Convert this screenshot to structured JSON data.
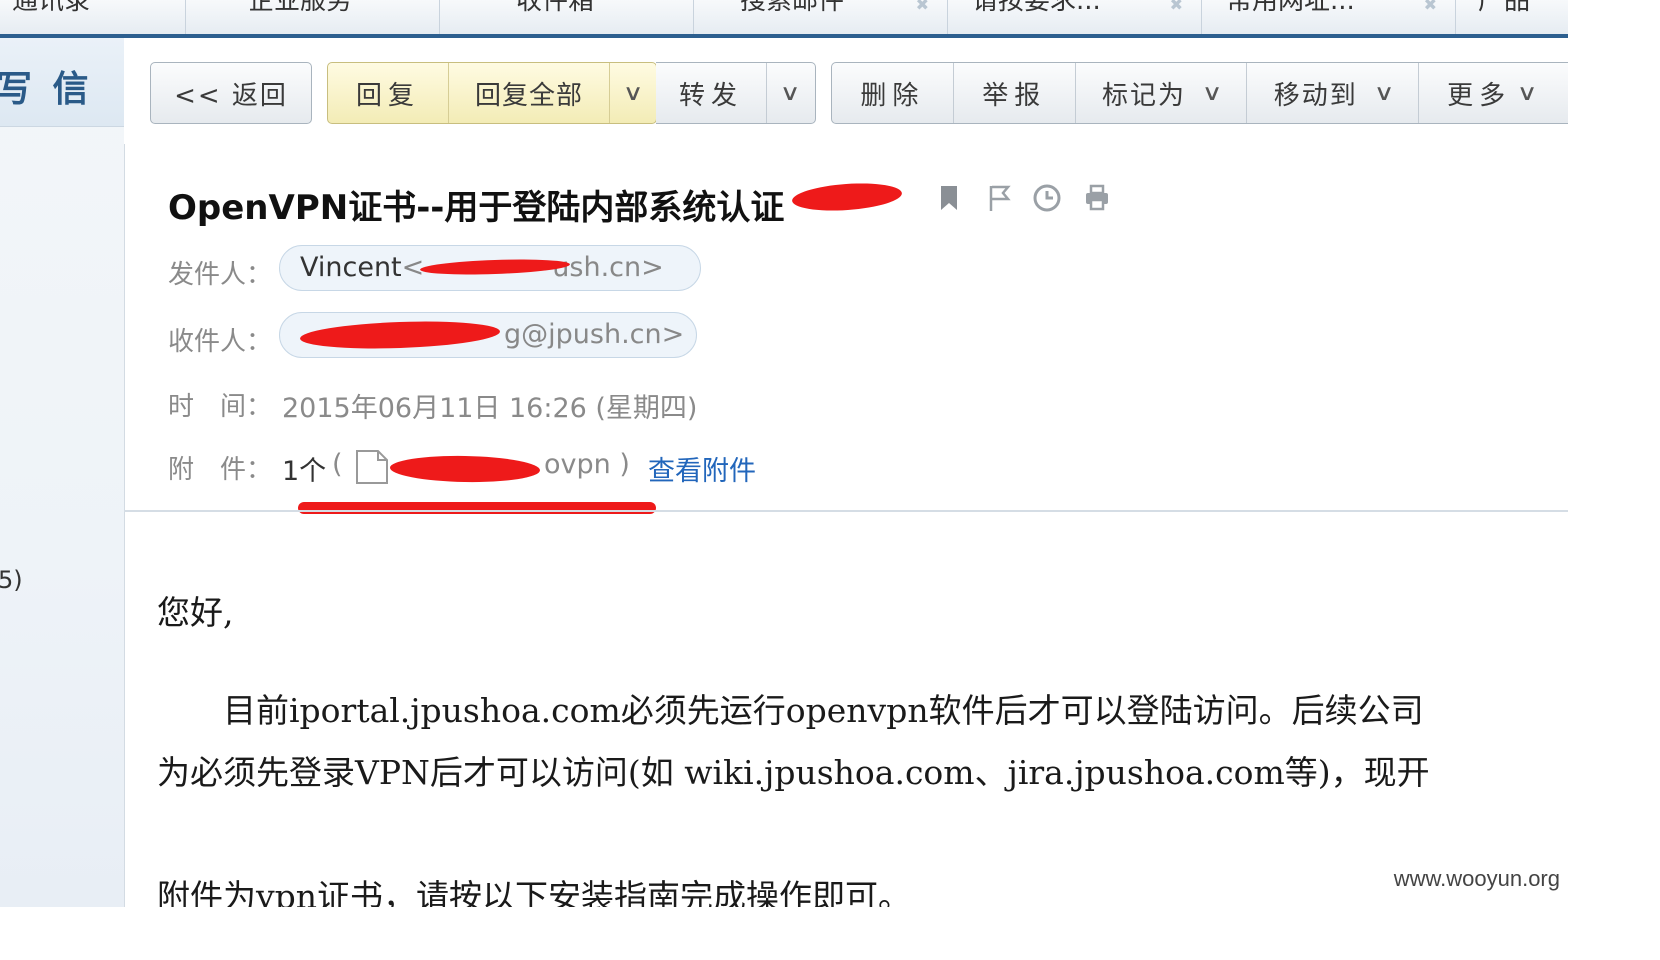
{
  "tabs": [
    {
      "label": "通讯录",
      "closable": false
    },
    {
      "label": "企业服务",
      "closable": false
    },
    {
      "label": "收件箱",
      "closable": false
    },
    {
      "label": "搜索邮件",
      "closable": true
    },
    {
      "label": "请按要求...",
      "closable": true
    },
    {
      "label": "常用网址...",
      "closable": true
    },
    {
      "label": "产品",
      "closable": false
    }
  ],
  "sidebar": {
    "compose_label": "写 信",
    "unread_fragment": "5)"
  },
  "toolbar": {
    "back": "<< 返回",
    "reply": "回复",
    "reply_all": "回复全部",
    "forward": "转发",
    "delete": "删除",
    "report": "举报",
    "mark_as": "标记为",
    "move_to": "移动到",
    "more": "更多"
  },
  "email": {
    "subject": "OpenVPN证书--用于登陆内部系统认证",
    "from_label": "发件人：",
    "from_name": "Vincent",
    "from_addr_visible": "<",
    "from_addr_tail": "ush.cn>",
    "to_label": "收件人：",
    "to_addr_tail": "g@jpush.cn>",
    "time_label": "时　间：",
    "time_value": "2015年06月11日 16:26 (星期四)",
    "attach_label": "附　件：",
    "attach_count": "1个",
    "attach_paren_open": "(",
    "attach_ext": "ovpn )",
    "view_attachment": "查看附件"
  },
  "body": {
    "greeting": "您好,",
    "para1_line1": "　　目前iportal.jpushoa.com必须先运行openvpn软件后才可以登陆访问。后续公司",
    "para1_line2": "为必须先登录VPN后才可以访问(如 wiki.jpushoa.com、jira.jpushoa.com等)，现开",
    "para2": "附件为vpn证书，请按以下安装指南完成操作即可。"
  },
  "watermark": "www.wooyun.org",
  "colors": {
    "tab_underline": "#2d5f8f",
    "link": "#2266bb",
    "redaction": "#ee1a1a",
    "reply_group_bg": "#f6f0c4"
  }
}
